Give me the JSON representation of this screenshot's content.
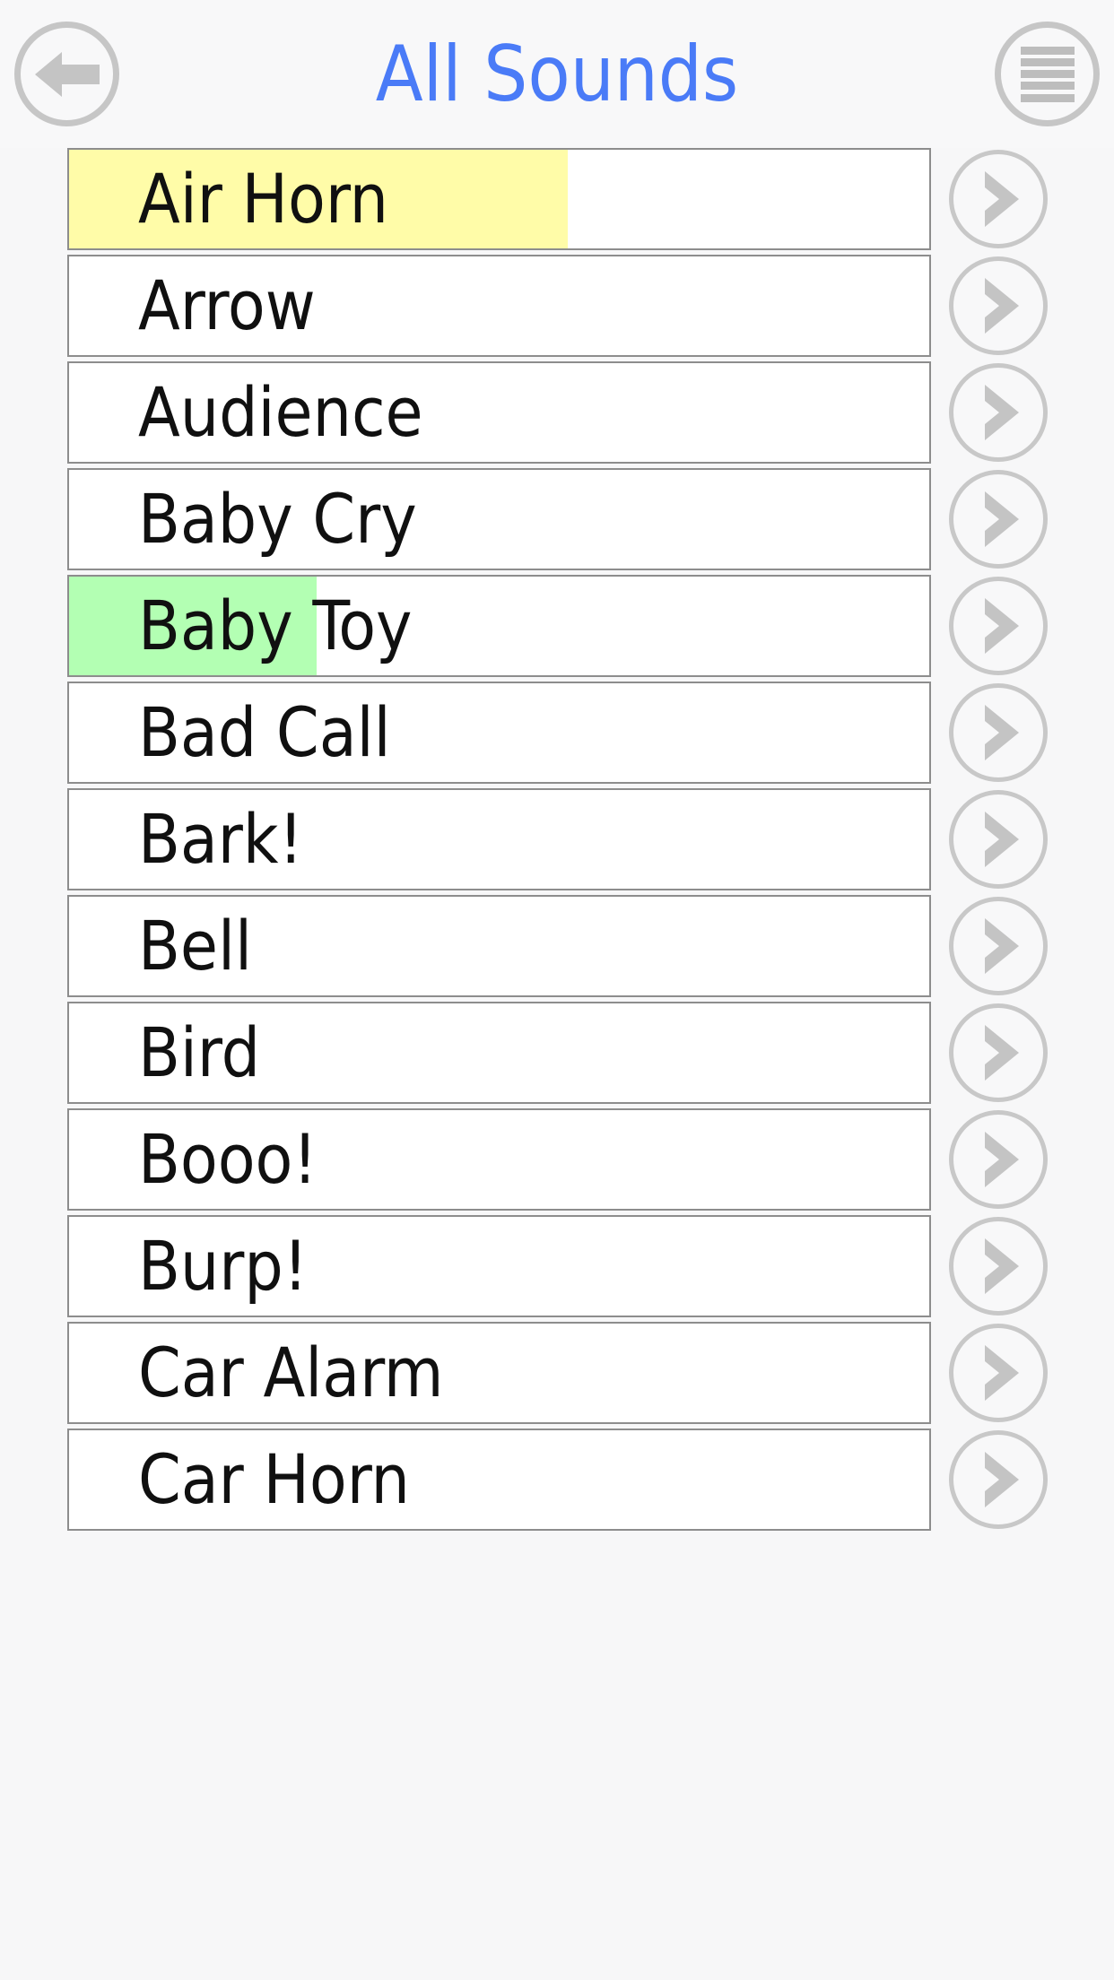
{
  "header": {
    "title": "All Sounds",
    "title_color": "#4a7bf7",
    "back_icon": "back-arrow-icon",
    "menu_icon": "hamburger-menu-icon",
    "menu_bars": 5
  },
  "colors": {
    "background": "#f7f7f8",
    "row_background": "#ffffff",
    "row_border": "#8d8d8d",
    "accent_blue": "#4a7bf7",
    "highlight_yellow": "#fffca8",
    "highlight_green": "#b3ffb3",
    "icon_gray": "#c6c6c6",
    "text": "#101010"
  },
  "list": {
    "chevron_icon": "chevron-right-icon",
    "items": [
      {
        "label": "Air Horn",
        "highlight": "#fffca8",
        "highlight_width": 556
      },
      {
        "label": "Arrow",
        "highlight": null,
        "highlight_width": 0
      },
      {
        "label": "Audience",
        "highlight": null,
        "highlight_width": 0
      },
      {
        "label": "Baby Cry",
        "highlight": null,
        "highlight_width": 0
      },
      {
        "label": "Baby Toy",
        "highlight": "#b3ffb3",
        "highlight_width": 276
      },
      {
        "label": "Bad Call",
        "highlight": null,
        "highlight_width": 0
      },
      {
        "label": "Bark!",
        "highlight": null,
        "highlight_width": 0
      },
      {
        "label": "Bell",
        "highlight": null,
        "highlight_width": 0
      },
      {
        "label": "Bird",
        "highlight": null,
        "highlight_width": 0
      },
      {
        "label": "Booo!",
        "highlight": null,
        "highlight_width": 0
      },
      {
        "label": "Burp!",
        "highlight": null,
        "highlight_width": 0
      },
      {
        "label": "Car Alarm",
        "highlight": null,
        "highlight_width": 0
      },
      {
        "label": "Car Horn",
        "highlight": null,
        "highlight_width": 0
      }
    ]
  }
}
